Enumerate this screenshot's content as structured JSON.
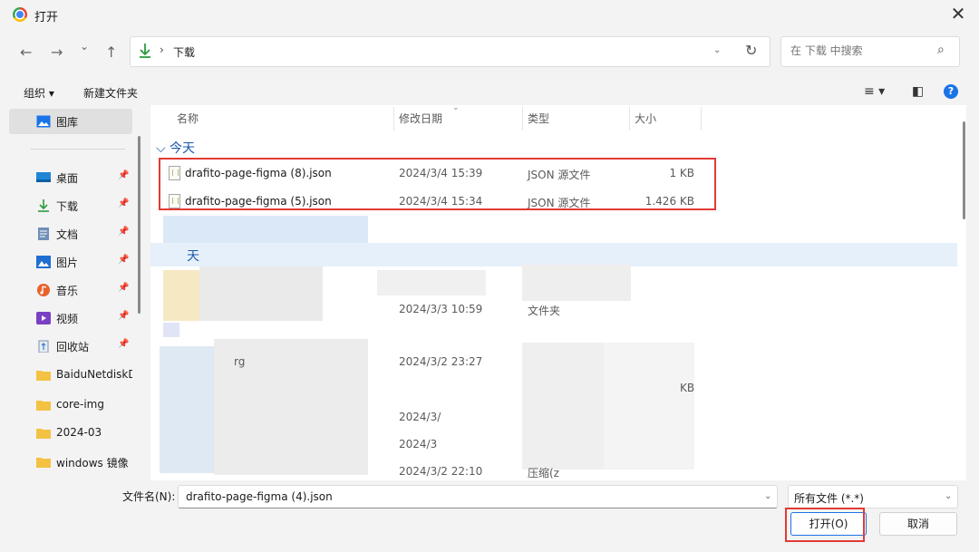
{
  "window": {
    "title": "打开",
    "close_symbol": "✕"
  },
  "nav": {
    "back": "←",
    "forward": "→",
    "history": "⌄",
    "up": "↑"
  },
  "address": {
    "separator": "›",
    "path": "下载",
    "dropdown": "⌄",
    "refresh": "↻"
  },
  "search": {
    "placeholder": "在 下载 中搜索",
    "icon": "⌕"
  },
  "toolbar": {
    "organize": "组织 ▾",
    "new_folder": "新建文件夹",
    "view_symbol": "≡ ▾",
    "pane_symbol": "◧",
    "help": "?"
  },
  "sidebar": {
    "items": [
      {
        "label": "图库",
        "icon": "gallery-icon",
        "pinned": false,
        "active": true
      },
      {
        "label": "桌面",
        "icon": "desktop-icon",
        "pinned": true
      },
      {
        "label": "下载",
        "icon": "download-icon",
        "pinned": true
      },
      {
        "label": "文档",
        "icon": "document-icon",
        "pinned": true
      },
      {
        "label": "图片",
        "icon": "pictures-icon",
        "pinned": true
      },
      {
        "label": "音乐",
        "icon": "music-icon",
        "pinned": true
      },
      {
        "label": "视频",
        "icon": "video-icon",
        "pinned": true
      },
      {
        "label": "回收站",
        "icon": "recycle-bin-icon",
        "pinned": true
      },
      {
        "label": "BaiduNetdiskD",
        "icon": "folder-icon",
        "pinned": false
      },
      {
        "label": "core-img",
        "icon": "folder-icon",
        "pinned": false
      },
      {
        "label": "2024-03",
        "icon": "folder-icon",
        "pinned": false
      },
      {
        "label": "windows 镜像",
        "icon": "folder-icon",
        "pinned": false
      }
    ],
    "pin_symbol": "📌"
  },
  "columns": {
    "name": "名称",
    "modified": "修改日期",
    "type": "类型",
    "size": "大小"
  },
  "groups": {
    "today": "⌵ 今天",
    "yesterday_partial": "天"
  },
  "files": [
    {
      "name": "drafito-page-figma (8).json",
      "date": "2024/3/4 15:39",
      "type": "JSON 源文件",
      "size": "1 KB"
    },
    {
      "name": "drafito-page-figma (5).json",
      "date": "2024/3/4 15:34",
      "type": "JSON 源文件",
      "size": "1.426 KB"
    }
  ],
  "obscured_rows": [
    {
      "date": "2024/3/3 10:59",
      "type": "文件夹"
    },
    {
      "name_fragment": "rg",
      "date": "2024/3/2 23:27"
    },
    {
      "type_fragment": "KB"
    },
    {
      "date": "2024/3/"
    },
    {
      "date": "2024/3"
    },
    {
      "date": "2024/3/2 22:10",
      "type": "压缩(z"
    }
  ],
  "bottom": {
    "filename_label": "文件名(N):",
    "filename_value": "drafito-page-figma (4).json",
    "filter_value": "所有文件 (*.*)",
    "open_button": "打开(O)",
    "cancel_button": "取消",
    "dropdown": "⌄"
  },
  "colors": {
    "accent": "#1a73e8",
    "highlight": "#e23a36",
    "group_text": "#1a56a8"
  }
}
